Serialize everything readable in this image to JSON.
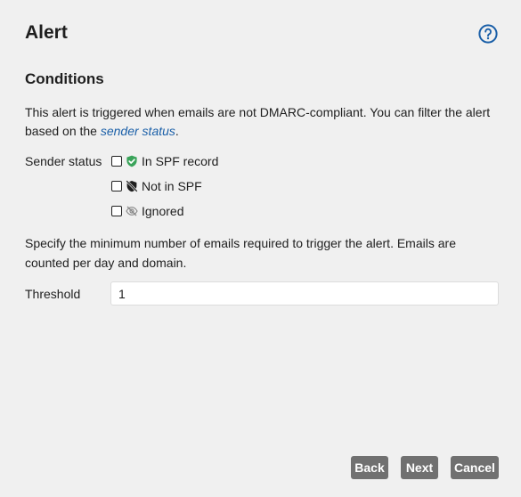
{
  "dialog": {
    "title": "Alert",
    "help_icon": "help-circle-icon"
  },
  "conditions": {
    "heading": "Conditions",
    "description_prefix": "This alert is triggered when emails are not DMARC-compliant. You can filter the alert based on the ",
    "description_link": "sender status",
    "description_suffix": ".",
    "sender_status_label": "Sender status",
    "options": [
      {
        "label": "In SPF record",
        "icon": "shield-check-icon",
        "checked": false
      },
      {
        "label": "Not in SPF",
        "icon": "shield-off-icon",
        "checked": false
      },
      {
        "label": "Ignored",
        "icon": "eye-off-icon",
        "checked": false
      }
    ],
    "threshold_description": "Specify the minimum number of emails required to trigger the alert. Emails are counted per day and domain.",
    "threshold_label": "Threshold",
    "threshold_value": "1"
  },
  "footer": {
    "back_label": "Back",
    "next_label": "Next",
    "cancel_label": "Cancel"
  },
  "colors": {
    "accent": "#1a5fa8",
    "button_bg": "#707070",
    "shield_green": "#3aa35a"
  }
}
